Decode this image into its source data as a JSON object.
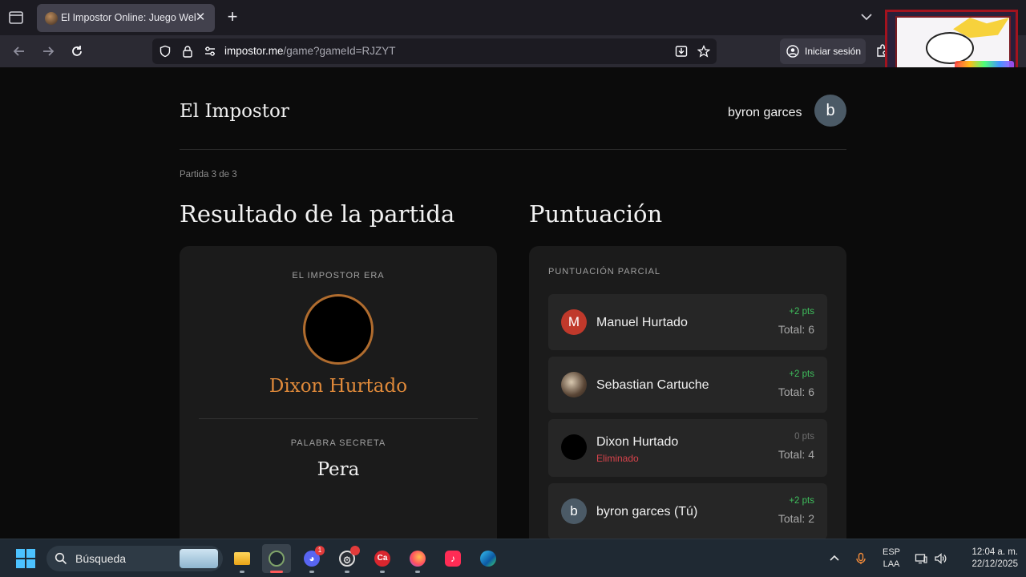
{
  "browser": {
    "tab_title": "El Impostor Online: Juego Web",
    "url_domain": "impostor.me",
    "url_path": "/game?gameId=RJZYT",
    "signin_label": "Iniciar sesión"
  },
  "header": {
    "site_title": "El Impostor",
    "user_name": "byron garces",
    "user_initial": "b"
  },
  "round_label": "Partida 3 de 3",
  "result": {
    "heading": "Resultado de la partida",
    "impostor_label": "EL IMPOSTOR ERA",
    "impostor_name": "Dixon Hurtado",
    "secret_label": "PALABRA SECRETA",
    "secret_word": "Pera"
  },
  "score": {
    "heading": "Puntuación",
    "section_label": "PUNTUACIÓN PARCIAL",
    "players": [
      {
        "initial": "M",
        "name": "Manuel Hurtado",
        "points": "+2 pts",
        "total": "Total: 6",
        "status": "",
        "avatar_color": "#c0392b"
      },
      {
        "initial": "",
        "name": "Sebastian Cartuche",
        "points": "+2 pts",
        "total": "Total: 6",
        "status": "",
        "avatar_color": "#6b5a48"
      },
      {
        "initial": "",
        "name": "Dixon Hurtado",
        "points": "0 pts",
        "total": "Total: 4",
        "status": "Eliminado",
        "avatar_color": "#000000"
      },
      {
        "initial": "b",
        "name": "byron garces (Tú)",
        "points": "+2 pts",
        "total": "Total: 2",
        "status": "",
        "avatar_color": "#4b5a66"
      }
    ]
  },
  "taskbar": {
    "search_placeholder": "Búsqueda",
    "discord_badge": "1",
    "lang_line1": "ESP",
    "lang_line2": "LAA",
    "time": "12:04 a. m.",
    "date": "22/12/2025"
  },
  "colors": {
    "accent_impostor": "#e08a3a",
    "points_positive": "#3fbf5d",
    "eliminated": "#d8434b"
  }
}
